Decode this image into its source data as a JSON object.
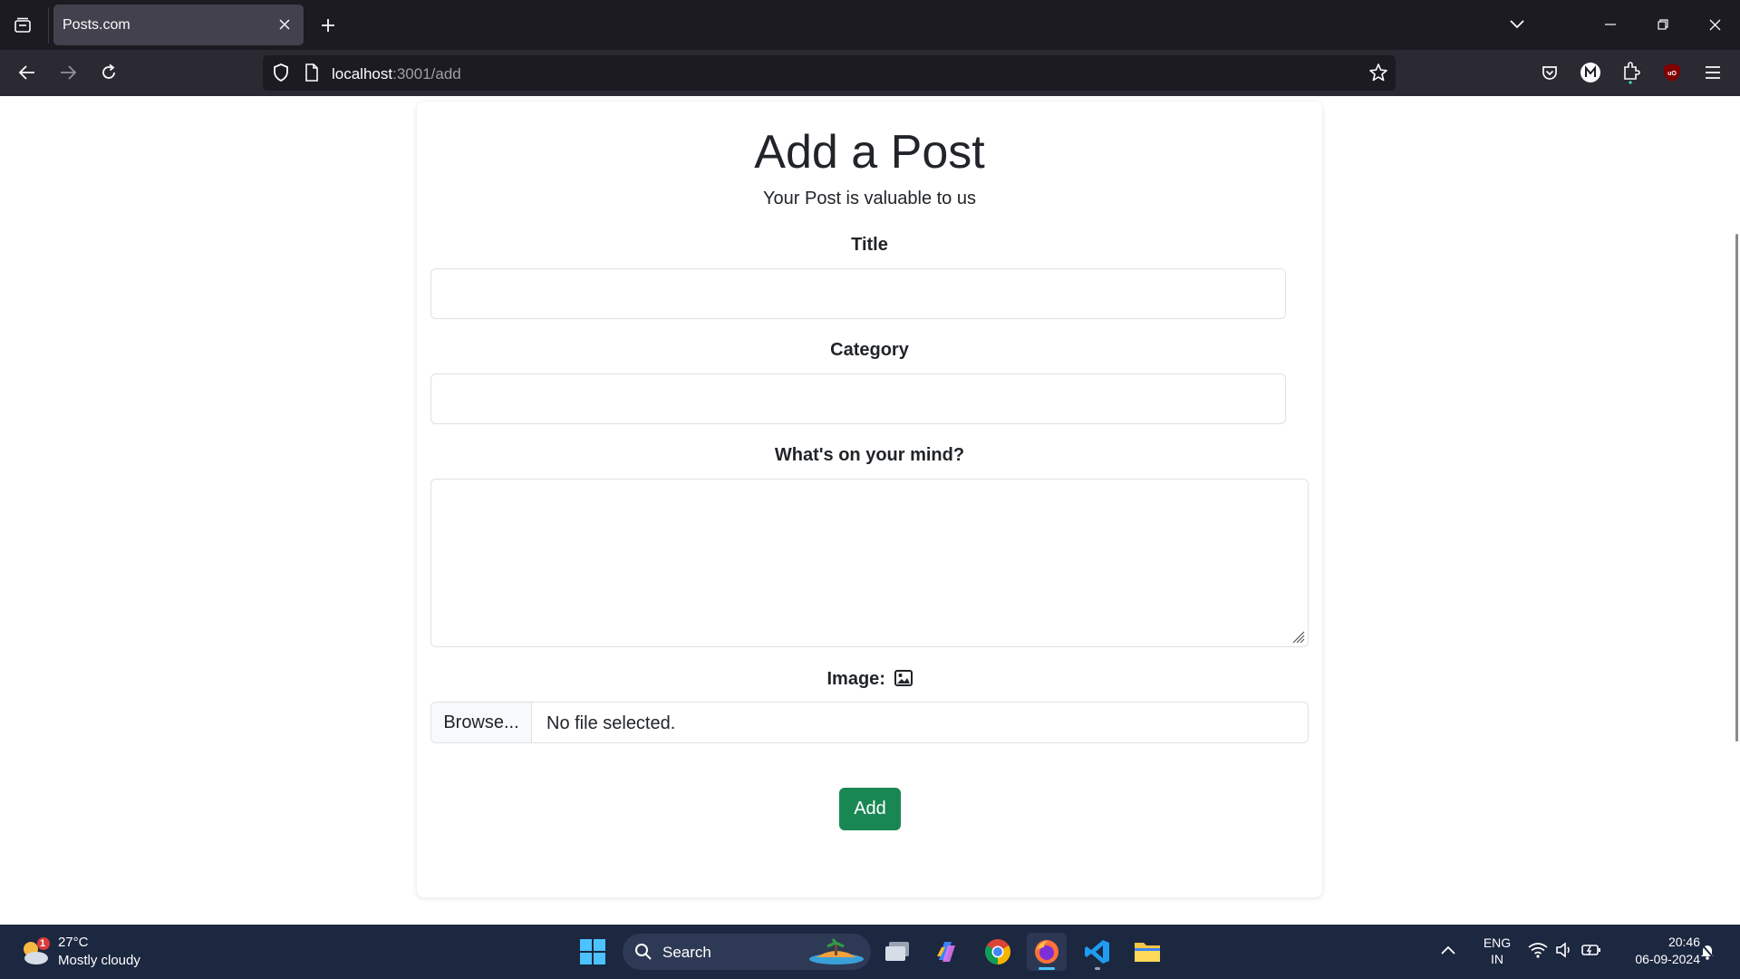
{
  "browser": {
    "tab_title": "Posts.com",
    "url_host": "localhost",
    "url_path": ":3001/add"
  },
  "page": {
    "heading": "Add a Post",
    "subheading": "Your Post is valuable to us",
    "title_label": "Title",
    "title_value": "",
    "category_label": "Category",
    "category_value": "",
    "mind_label": "What's on your mind?",
    "mind_value": "",
    "image_label": "Image:",
    "browse_label": "Browse...",
    "file_status": "No file selected.",
    "submit_label": "Add"
  },
  "taskbar": {
    "weather_badge": "1",
    "weather_temp": "27°C",
    "weather_desc": "Mostly cloudy",
    "search_label": "Search",
    "lang_line1": "ENG",
    "lang_line2": "IN",
    "time": "20:46",
    "date": "06-09-2024"
  },
  "colors": {
    "tab_bar": "#1c1b22",
    "nav_bar": "#2b2a33",
    "submit_button": "#198754",
    "taskbar": "#1c2740"
  }
}
